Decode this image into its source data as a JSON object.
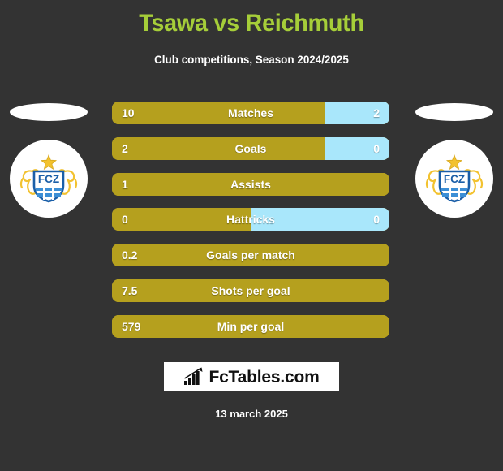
{
  "header": {
    "title": "Tsawa vs Reichmuth",
    "subtitle": "Club competitions, Season 2024/2025",
    "title_color": "#a6ce39",
    "subtitle_color": "#ffffff"
  },
  "colors": {
    "background": "#333333",
    "home_bar": "#b5a01e",
    "away_bar": "#a9e7fb",
    "brand_background": "#ffffff",
    "badge_background": "#ffffff"
  },
  "home": {
    "photo": "player-photo-placeholder",
    "club_badge": "fcz-club-crest",
    "club_badge_text": "FCZ"
  },
  "away": {
    "photo": "player-photo-placeholder",
    "club_badge": "fcz-club-crest",
    "club_badge_text": "FCZ"
  },
  "stats": [
    {
      "label": "Matches",
      "home": "10",
      "away": "2",
      "home_pct": 77
    },
    {
      "label": "Goals",
      "home": "2",
      "away": "0",
      "home_pct": 77
    },
    {
      "label": "Assists",
      "home": "1",
      "away": "",
      "home_pct": 100
    },
    {
      "label": "Hattricks",
      "home": "0",
      "away": "0",
      "home_pct": 50
    },
    {
      "label": "Goals per match",
      "home": "0.2",
      "away": "",
      "home_pct": 100
    },
    {
      "label": "Shots per goal",
      "home": "7.5",
      "away": "",
      "home_pct": 100
    },
    {
      "label": "Min per goal",
      "home": "579",
      "away": "",
      "home_pct": 100
    }
  ],
  "brand": {
    "name": "FcTables.com",
    "icon": "bar-chart-growth-icon"
  },
  "footer": {
    "date": "13 march 2025"
  }
}
